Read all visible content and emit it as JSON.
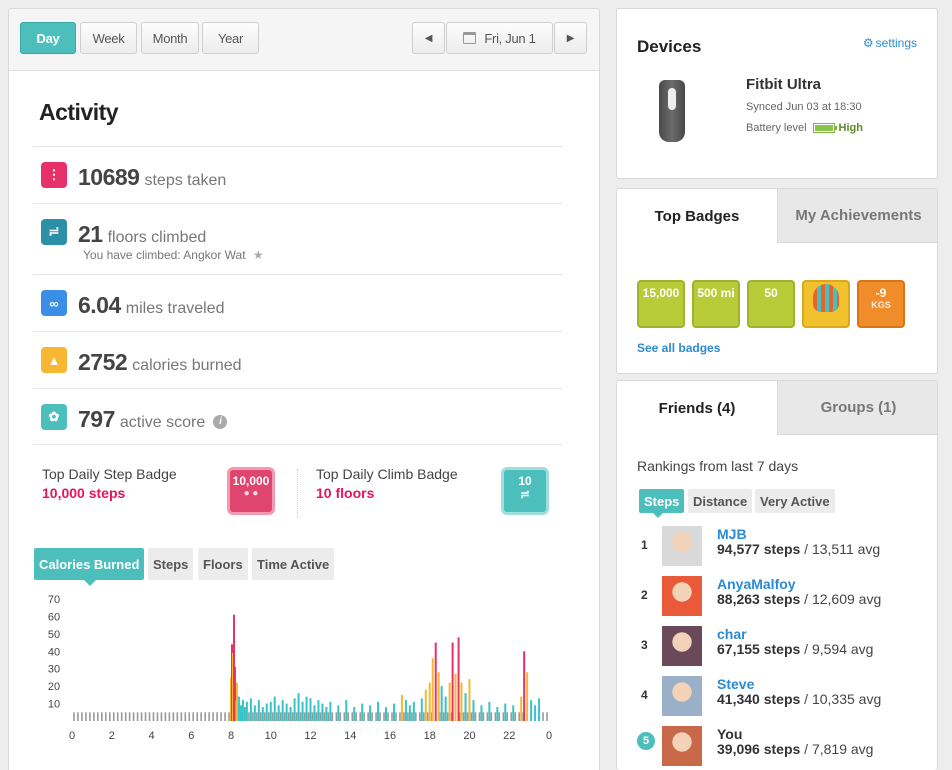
{
  "range_tabs": [
    "Day",
    "Week",
    "Month",
    "Year"
  ],
  "date_label": "Fri, Jun 1",
  "activity": {
    "title": "Activity",
    "steps": {
      "value": "10689",
      "unit": "steps taken"
    },
    "floors": {
      "value": "21",
      "unit": "floors climbed",
      "sub": "You have climbed: Angkor Wat"
    },
    "miles": {
      "value": "6.04",
      "unit": "miles traveled"
    },
    "calories": {
      "value": "2752",
      "unit": "calories burned"
    },
    "active": {
      "value": "797",
      "unit": "active score"
    }
  },
  "daily_badges": {
    "step": {
      "title": "Top Daily Step Badge",
      "value": "10,000 steps",
      "badge_text": "10,000"
    },
    "climb": {
      "title": "Top Daily Climb Badge",
      "value": "10 floors",
      "badge_text": "10"
    }
  },
  "chart_tabs": [
    "Calories Burned",
    "Steps",
    "Floors",
    "Time Active"
  ],
  "chart_data": {
    "type": "bar",
    "title": "Calories Burned",
    "x_ticks": [
      0,
      2,
      4,
      6,
      8,
      10,
      12,
      14,
      16,
      18,
      20,
      22,
      0
    ],
    "y_ticks": [
      10,
      20,
      30,
      40,
      50,
      60,
      70
    ],
    "ylim": [
      0,
      70
    ],
    "baseline": 5,
    "colors": {
      "low": "#9a9a9a",
      "active": "#38c4c6",
      "moderate": "#f7b733",
      "high": "#e8316a"
    },
    "bars": [
      {
        "x": 8.0,
        "v": 25,
        "c": "moderate"
      },
      {
        "x": 8.05,
        "v": 44,
        "c": "high"
      },
      {
        "x": 8.1,
        "v": 39,
        "c": "moderate"
      },
      {
        "x": 8.15,
        "v": 61,
        "c": "high"
      },
      {
        "x": 8.2,
        "v": 31,
        "c": "high"
      },
      {
        "x": 8.25,
        "v": 12,
        "c": "active"
      },
      {
        "x": 8.3,
        "v": 22,
        "c": "moderate"
      },
      {
        "x": 8.4,
        "v": 14,
        "c": "active"
      },
      {
        "x": 8.5,
        "v": 9,
        "c": "active"
      },
      {
        "x": 8.6,
        "v": 12,
        "c": "active"
      },
      {
        "x": 8.7,
        "v": 8,
        "c": "active"
      },
      {
        "x": 8.8,
        "v": 11,
        "c": "active"
      },
      {
        "x": 9.0,
        "v": 13,
        "c": "active"
      },
      {
        "x": 9.2,
        "v": 9,
        "c": "active"
      },
      {
        "x": 9.4,
        "v": 12,
        "c": "active"
      },
      {
        "x": 9.6,
        "v": 8,
        "c": "active"
      },
      {
        "x": 9.8,
        "v": 10,
        "c": "active"
      },
      {
        "x": 10.0,
        "v": 11,
        "c": "active"
      },
      {
        "x": 10.2,
        "v": 14,
        "c": "active"
      },
      {
        "x": 10.4,
        "v": 9,
        "c": "active"
      },
      {
        "x": 10.6,
        "v": 12,
        "c": "active"
      },
      {
        "x": 10.8,
        "v": 10,
        "c": "active"
      },
      {
        "x": 11.0,
        "v": 8,
        "c": "active"
      },
      {
        "x": 11.2,
        "v": 13,
        "c": "active"
      },
      {
        "x": 11.4,
        "v": 16,
        "c": "active"
      },
      {
        "x": 11.6,
        "v": 11,
        "c": "active"
      },
      {
        "x": 11.8,
        "v": 14,
        "c": "active"
      },
      {
        "x": 12.0,
        "v": 13,
        "c": "active"
      },
      {
        "x": 12.2,
        "v": 9,
        "c": "active"
      },
      {
        "x": 12.4,
        "v": 12,
        "c": "active"
      },
      {
        "x": 12.6,
        "v": 10,
        "c": "active"
      },
      {
        "x": 12.8,
        "v": 8,
        "c": "active"
      },
      {
        "x": 13.0,
        "v": 11,
        "c": "active"
      },
      {
        "x": 13.4,
        "v": 9,
        "c": "active"
      },
      {
        "x": 13.8,
        "v": 12,
        "c": "active"
      },
      {
        "x": 14.2,
        "v": 8,
        "c": "active"
      },
      {
        "x": 14.6,
        "v": 10,
        "c": "active"
      },
      {
        "x": 15.0,
        "v": 9,
        "c": "active"
      },
      {
        "x": 15.4,
        "v": 11,
        "c": "active"
      },
      {
        "x": 15.8,
        "v": 8,
        "c": "active"
      },
      {
        "x": 16.2,
        "v": 10,
        "c": "active"
      },
      {
        "x": 16.6,
        "v": 15,
        "c": "moderate"
      },
      {
        "x": 16.8,
        "v": 12,
        "c": "active"
      },
      {
        "x": 17.0,
        "v": 9,
        "c": "active"
      },
      {
        "x": 17.2,
        "v": 11,
        "c": "active"
      },
      {
        "x": 17.6,
        "v": 13,
        "c": "active"
      },
      {
        "x": 17.8,
        "v": 18,
        "c": "moderate"
      },
      {
        "x": 18.0,
        "v": 22,
        "c": "moderate"
      },
      {
        "x": 18.15,
        "v": 36,
        "c": "moderate"
      },
      {
        "x": 18.3,
        "v": 45,
        "c": "high"
      },
      {
        "x": 18.45,
        "v": 28,
        "c": "moderate"
      },
      {
        "x": 18.6,
        "v": 20,
        "c": "active"
      },
      {
        "x": 18.8,
        "v": 14,
        "c": "active"
      },
      {
        "x": 19.0,
        "v": 22,
        "c": "moderate"
      },
      {
        "x": 19.15,
        "v": 45,
        "c": "high"
      },
      {
        "x": 19.3,
        "v": 27,
        "c": "moderate"
      },
      {
        "x": 19.45,
        "v": 48,
        "c": "high"
      },
      {
        "x": 19.6,
        "v": 22,
        "c": "moderate"
      },
      {
        "x": 19.8,
        "v": 16,
        "c": "active"
      },
      {
        "x": 20.0,
        "v": 24,
        "c": "moderate"
      },
      {
        "x": 20.2,
        "v": 12,
        "c": "active"
      },
      {
        "x": 20.6,
        "v": 9,
        "c": "active"
      },
      {
        "x": 21.0,
        "v": 11,
        "c": "active"
      },
      {
        "x": 21.4,
        "v": 8,
        "c": "active"
      },
      {
        "x": 21.8,
        "v": 10,
        "c": "active"
      },
      {
        "x": 22.2,
        "v": 9,
        "c": "active"
      },
      {
        "x": 22.6,
        "v": 14,
        "c": "moderate"
      },
      {
        "x": 22.75,
        "v": 40,
        "c": "high"
      },
      {
        "x": 22.9,
        "v": 28,
        "c": "moderate"
      },
      {
        "x": 23.1,
        "v": 12,
        "c": "active"
      },
      {
        "x": 23.3,
        "v": 9,
        "c": "active"
      },
      {
        "x": 23.5,
        "v": 13,
        "c": "active"
      }
    ]
  },
  "devices": {
    "title": "Devices",
    "settings_label": "settings",
    "name": "Fitbit Ultra",
    "synced": "Synced Jun 03 at 18:30",
    "battery_label": "Battery level",
    "battery_value": "High",
    "battery_color": "#8bc34a"
  },
  "badges_panel": {
    "tabs": [
      "Top Badges",
      "My Achievements"
    ],
    "items": [
      {
        "icon": "steps-badge-icon",
        "text": "15,000",
        "color": "#b8cc3a"
      },
      {
        "icon": "trophy-badge-icon",
        "text": "500 mi",
        "color": "#b8cc3a"
      },
      {
        "icon": "stairs-badge-icon",
        "text": "50",
        "color": "#b8cc3a"
      },
      {
        "icon": "balloon-badge-icon",
        "text": "",
        "color": "#f2c22e"
      },
      {
        "icon": "weight-loss-badge-icon",
        "text": "-9",
        "sub": "KGS",
        "color": "#f08c2a"
      }
    ],
    "see_all": "See all badges"
  },
  "friends_panel": {
    "tabs": [
      "Friends (4)",
      "Groups (1)"
    ],
    "rankings_label": "Rankings from last 7 days",
    "filters": [
      "Steps",
      "Distance",
      "Very Active"
    ],
    "rows": [
      {
        "rank": "1",
        "name": "MJB",
        "steps": "94,577 steps",
        "avg": " / 13,511 avg",
        "avatar": "#d9d9d9"
      },
      {
        "rank": "2",
        "name": "AnyaMalfoy",
        "steps": "88,263 steps",
        "avg": " / 12,609 avg",
        "avatar": "#e85a3a"
      },
      {
        "rank": "3",
        "name": "char",
        "steps": "67,155 steps",
        "avg": " / 9,594 avg",
        "avatar": "#6a4a5a"
      },
      {
        "rank": "4",
        "name": "Steve",
        "steps": "41,340 steps",
        "avg": " / 10,335 avg",
        "avatar": "#9ab0c8"
      },
      {
        "rank": "5",
        "name": "You",
        "steps": "39,096 steps",
        "avg": " / 7,819 avg",
        "avatar": "#c86a4a"
      }
    ]
  }
}
